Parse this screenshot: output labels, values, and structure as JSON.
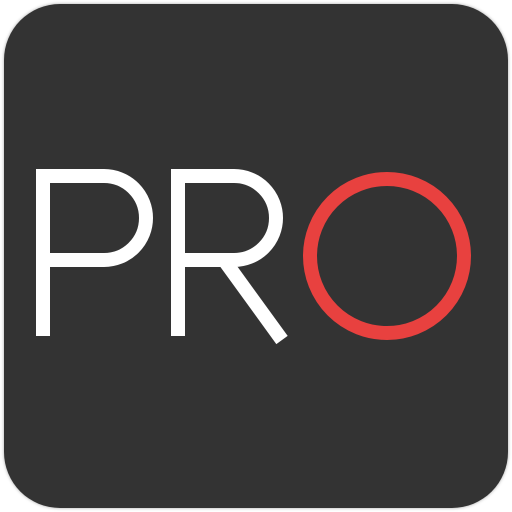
{
  "app_icon": {
    "logo_text": "PRO",
    "letters": [
      "P",
      "R",
      "O"
    ],
    "icon_name": "pro-logo-icon",
    "colors": {
      "background": "#333333",
      "letters": "#ffffff",
      "accent": "#e8413f"
    }
  }
}
